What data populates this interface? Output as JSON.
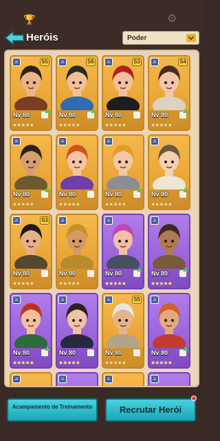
{
  "header": {
    "title": "Heróis",
    "sort_value": "Poder"
  },
  "cards": [
    {
      "level": "Nv 80",
      "rank": "5",
      "stars": "★★★★★",
      "variant": "gold",
      "hair": "#2b2321",
      "skin": "#e8b48a",
      "outfit": "#7a3d22",
      "up": true
    },
    {
      "level": "Nv 80",
      "rank": "6",
      "stars": "★★★★★",
      "variant": "gold",
      "hair": "#2a2a2a",
      "skin": "#f0c09a",
      "outfit": "#2f6cb3",
      "up": true
    },
    {
      "level": "Nv 80",
      "rank": "3",
      "stars": "★★★★★",
      "variant": "gold",
      "hair": "#b5211d",
      "skin": "#f2bfa0",
      "outfit": "#1e1e22",
      "up": false
    },
    {
      "level": "Nv 80",
      "rank": "4",
      "stars": "★★★★★",
      "variant": "gold",
      "hair": "#4a2d22",
      "skin": "#f2c6aa",
      "outfit": "#ddd2be",
      "up": true
    },
    {
      "level": "Nv 80",
      "rank": "",
      "stars": "★★★★★",
      "variant": "gold",
      "hair": "#2a2220",
      "skin": "#d59e73",
      "outfit": "#6b5a34",
      "up": true
    },
    {
      "level": "Nv 80",
      "rank": "",
      "stars": "★★★★★",
      "variant": "gold",
      "hair": "#d1511d",
      "skin": "#f4c3a3",
      "outfit": "#6e3fa8",
      "up": false
    },
    {
      "level": "Nv 80",
      "rank": "",
      "stars": "★★★★★",
      "variant": "gold",
      "hair": "#e59a2a",
      "skin": "#f2c7a5",
      "outfit": "#8d8d96",
      "up": true
    },
    {
      "level": "Nv 80",
      "rank": "",
      "stars": "★★★★★",
      "variant": "gold",
      "hair": "#6c5742",
      "skin": "#f1d1b1",
      "outfit": "#ede6d6",
      "up": true
    },
    {
      "level": "Nv 80",
      "rank": "3",
      "stars": "★★★★★",
      "variant": "gold",
      "hair": "#1e1a1c",
      "skin": "#e6b08a",
      "outfit": "#55482c",
      "up": false
    },
    {
      "level": "Nv 80",
      "rank": "",
      "stars": "★★★★★",
      "variant": "gold",
      "hair": "#c5922a",
      "skin": "#d49a66",
      "outfit": "#b78a2d",
      "up": false
    },
    {
      "level": "Nv 80",
      "rank": "",
      "stars": "★★★★★",
      "variant": "purple",
      "hair": "#c246b9",
      "skin": "#f0c0a2",
      "outfit": "#4a4e62",
      "up": true
    },
    {
      "level": "Nv 80",
      "rank": "",
      "stars": "★★★★★",
      "variant": "purple",
      "hair": "#3b2b25",
      "skin": "#b07a52",
      "outfit": "#7a5a3a",
      "up": true
    },
    {
      "level": "Nv 80",
      "rank": "",
      "stars": "★★★★★",
      "variant": "purple",
      "hair": "#c0301f",
      "skin": "#f1c19f",
      "outfit": "#2d6b3a",
      "up": true
    },
    {
      "level": "Nv 80",
      "rank": "",
      "stars": "★★★★★",
      "variant": "purple",
      "hair": "#2b2123",
      "skin": "#f0c3a5",
      "outfit": "#262a3f",
      "up": false
    },
    {
      "level": "Nv 80",
      "rank": "5",
      "stars": "★★★★★",
      "variant": "gold",
      "hair": "#e6e6e2",
      "skin": "#e6b48a",
      "outfit": "#b3a38a",
      "up": false
    },
    {
      "level": "Nv 80",
      "rank": "",
      "stars": "★★★★★",
      "variant": "purple",
      "hair": "#d45f29",
      "skin": "#e4a983",
      "outfit": "#c23b2e",
      "up": true
    }
  ],
  "partial_cards": [
    {
      "variant": "gold"
    },
    {
      "variant": "purple"
    },
    {
      "variant": "gold"
    },
    {
      "variant": "purple"
    }
  ],
  "buttons": {
    "training_camp": "Acampamento de Treinamento",
    "recruit_hero": "Recrutar Herói"
  },
  "colors": {
    "accent_cyan": "#1aa7b7",
    "gold_card": "#e19a2b",
    "purple_card": "#8c52d2"
  }
}
